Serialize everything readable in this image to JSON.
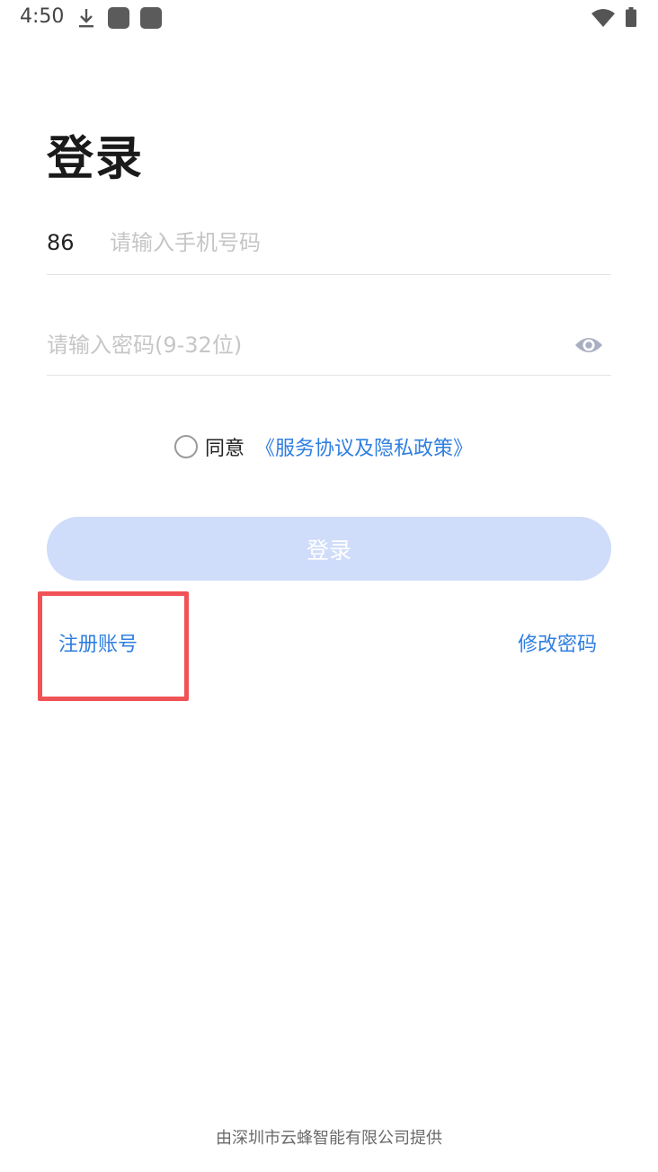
{
  "status_bar": {
    "time": "4:50",
    "icons": [
      "download-icon",
      "app-notification-icon",
      "app-notification-icon",
      "wifi-icon",
      "battery-icon"
    ]
  },
  "title": "登录",
  "phone": {
    "country_code": "86",
    "placeholder": "请输入手机号码",
    "value": ""
  },
  "password": {
    "placeholder": "请输入密码(9-32位)",
    "value": "",
    "toggle_icon": "eye-icon"
  },
  "agreement": {
    "checked": false,
    "label": "同意",
    "link": "《服务协议及隐私政策》"
  },
  "login_button": "登录",
  "links": {
    "register": "注册账号",
    "change_password": "修改密码"
  },
  "footer": "由深圳市云蜂智能有限公司提供",
  "colors": {
    "accent": "#2f7fe0",
    "button_disabled_bg": "#cfdcfa",
    "highlight": "#f05357"
  }
}
